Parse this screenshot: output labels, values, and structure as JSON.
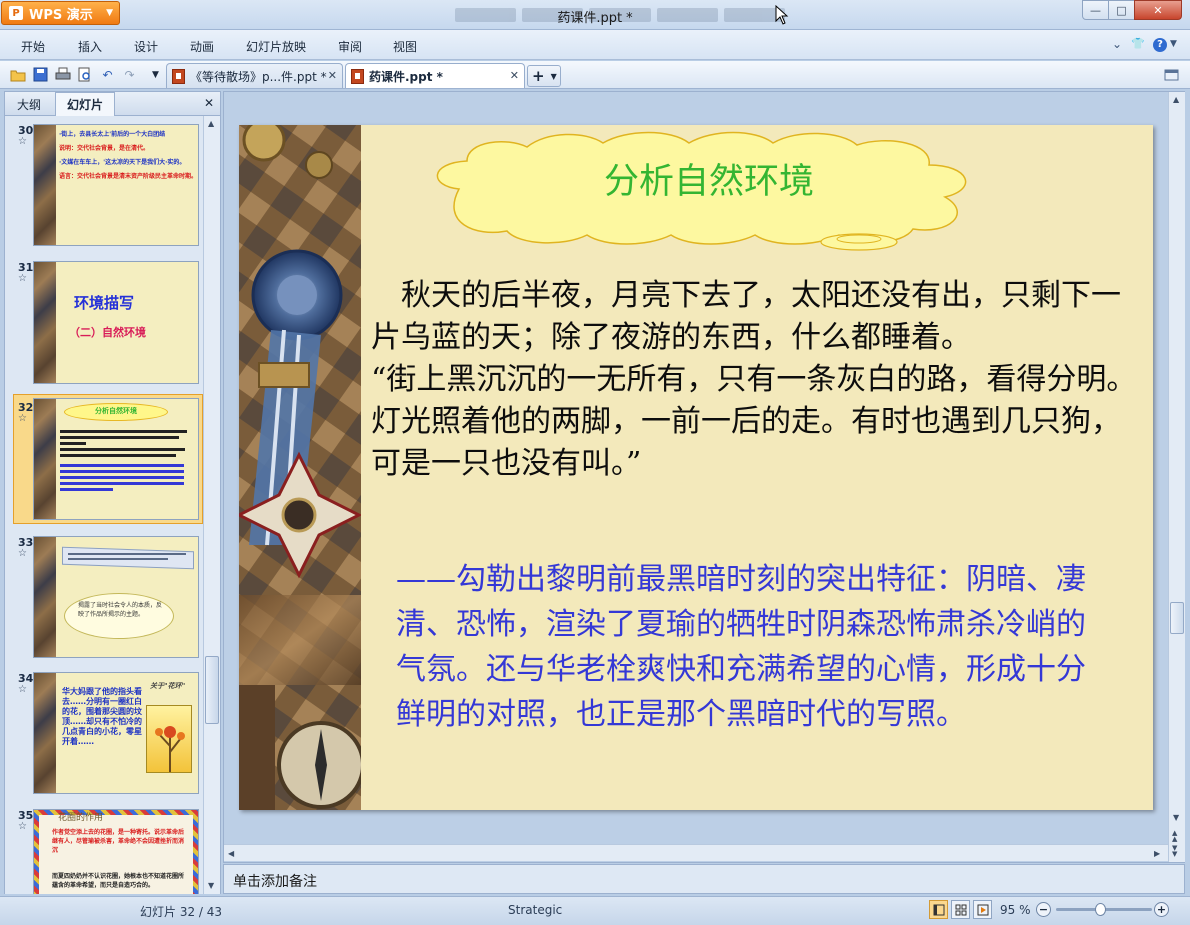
{
  "app": {
    "name": "WPS 演示",
    "logo_letter": "P",
    "document_title": "药课件.ppt *"
  },
  "window_controls": {
    "minimize": "—",
    "maximize": "□",
    "close": "✕"
  },
  "menu": {
    "items": [
      "开始",
      "插入",
      "设计",
      "动画",
      "幻灯片放映",
      "审阅",
      "视图"
    ],
    "right": {
      "collapse": "⌄",
      "skin": "👕",
      "help": "?"
    }
  },
  "toolbar": {
    "icons": [
      "open-folder-icon",
      "save-icon",
      "print-icon",
      "print-preview-icon",
      "undo-icon",
      "redo-icon",
      "customize-icon"
    ]
  },
  "tabs": [
    {
      "label": "《等待散场》p...件.ppt *",
      "close": "✕",
      "active": false
    },
    {
      "label": "药课件.ppt *",
      "close": "✕",
      "active": true
    }
  ],
  "add_tab": "+",
  "panel": {
    "tabs": [
      "大纲",
      "幻灯片"
    ],
    "active_tab": "幻灯片",
    "close": "✕"
  },
  "thumbnails": [
    {
      "number": "30",
      "star": "☆",
      "lines": [
        {
          "text": "·街上，去县长太上'前后的一个大白团结",
          "color": "#1e33c4"
        },
        {
          "text": "说明：交代社会背景，是在清代。",
          "color": "#d91d1d"
        },
        {
          "text": "·文媒在车车上，'这太凉的天下是我们大·实的。",
          "color": "#1e33c4"
        },
        {
          "text": "语言：交代社会背景是清末资产阶级民主革命时期。",
          "color": "#d91d1d"
        }
      ]
    },
    {
      "number": "31",
      "star": "☆",
      "title": "环境描写",
      "subtitle": "（二）自然环境"
    },
    {
      "number": "32",
      "star": "☆",
      "selected": true,
      "title": "分析自然环境"
    },
    {
      "number": "33",
      "star": "☆",
      "lines": [
        {
          "text": "揭露了当时社会令人的本质，反映了作品所揭示的主题。",
          "color": "#333333"
        }
      ]
    },
    {
      "number": "34",
      "star": "☆",
      "tag": "关于\"花环\"",
      "lines": [
        {
          "text": "华大妈跟了他的指头看去……分明有一圈红白的花，围着那尖圆的坟顶……却只有不怕冷的几点青白的小花，零星开着……",
          "color": "#1e33c4"
        }
      ]
    },
    {
      "number": "35",
      "star": "☆",
      "title": "花圈的作用",
      "lines": [
        {
          "text": "作者觉空添上去的花圈，是一种寄托。说示革命后继有人，尽管瑜被杀害，革命绝不会因遭挫折而消沉",
          "color": "#d91d1d"
        },
        {
          "text": "而夏四奶奶并不认识花圈，她根本也不知道花圈所蕴含的革命希望，而只是自造巧合的。",
          "color": "#222222"
        }
      ]
    }
  ],
  "slide": {
    "title": "分析自然环境",
    "paragraph": "　秋天的后半夜，月亮下去了，太阳还没有出，只剩下一片乌蓝的天；除了夜游的东西，什么都睡着。\n“街上黑沉沉的一无所有，只有一条灰白的路，看得分明。灯光照着他的两脚，一前一后的走。有时也遇到几只狗，可是一只也没有叫。”",
    "analysis": "——勾勒出黎明前最黑暗时刻的突出特征：阴暗、凄清、恐怖，渲染了夏瑜的牺牲时阴森恐怖肃杀冷峭的气氛。还与华老栓爽快和充满希望的心情，形成十分鲜明的对照，也正是那个黑暗时代的写照。"
  },
  "notes_placeholder": "单击添加备注",
  "status": {
    "slide_counter": "幻灯片 32 / 43",
    "theme": "Strategic",
    "zoom": "95 %",
    "zoom_level_percent": 95,
    "zoom_out": "−",
    "zoom_in": "+"
  },
  "colors": {
    "title_green": "#34b532",
    "analysis_blue": "#3438d6",
    "slide_bg": "#f3e9bb",
    "wps_orange": "#f07a12"
  }
}
